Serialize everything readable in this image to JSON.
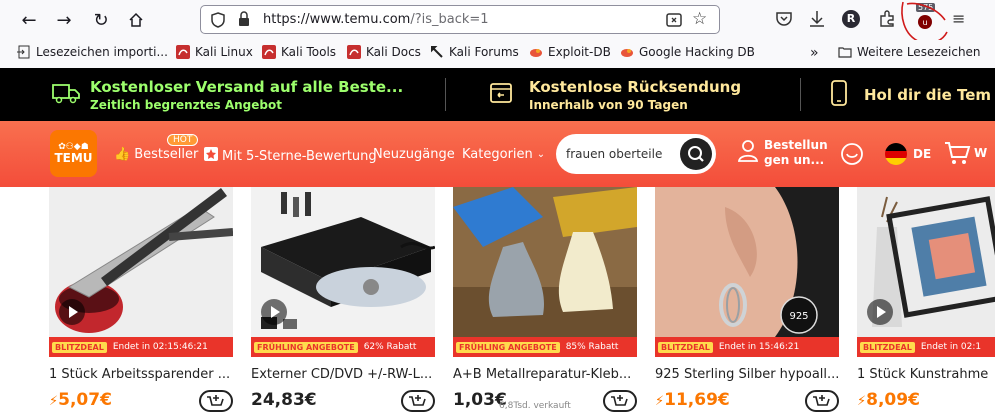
{
  "browser": {
    "url_main": "https://www.temu.com",
    "url_rest": "/?is_back=1",
    "badge_count": "575",
    "profile_letter": "R"
  },
  "bookmarks": [
    {
      "label": "Lesezeichen importi...",
      "icon": "import-icon"
    },
    {
      "label": "Kali Linux",
      "icon": "kali-icon"
    },
    {
      "label": "Kali Tools",
      "icon": "kali-icon"
    },
    {
      "label": "Kali Docs",
      "icon": "kali-icon"
    },
    {
      "label": "Kali Forums",
      "icon": "kali-forum-icon"
    },
    {
      "label": "Exploit-DB",
      "icon": "exploit-icon"
    },
    {
      "label": "Google Hacking DB",
      "icon": "exploit-icon"
    }
  ],
  "bookmarks_more": "Weitere Lesezeichen",
  "promo": [
    {
      "title": "Kostenloser Versand auf alle Beste...",
      "sub": "Zeitlich begrenztes Angebot"
    },
    {
      "title": "Kostenlose Rücksendung",
      "sub": "Innerhalb von 90 Tagen"
    },
    {
      "title": "Hol dir die Tem",
      "sub": ""
    }
  ],
  "header": {
    "logo_text": "TEMU",
    "hot": "HOT",
    "nav": [
      "Bestseller",
      "Mit 5-Sterne-Bewertung",
      "Neuzugänge",
      "Kategorien"
    ],
    "search_placeholder": "frauen oberteile",
    "orders_line1": "Bestellun",
    "orders_line2": "gen un...",
    "lang": "DE",
    "cart_letter": "W"
  },
  "products": [
    {
      "title": "1 Stück Arbeitssparender ...",
      "price": "5,07€",
      "deal_badge": "BLITZDEAL",
      "deal_text": "Endet in 02:15:46:21",
      "sold": "",
      "price_color": "orange"
    },
    {
      "title": "Externer CD/DVD +/-RW-L...",
      "price": "24,83€",
      "deal_badge": "FRÜHLING ANGEBOTE",
      "deal_text": "62% Rabatt",
      "sold": "",
      "price_color": "black"
    },
    {
      "title": "A+B Metallreparatur-Kleb...",
      "price": "1,03€",
      "deal_badge": "FRÜHLING ANGEBOTE",
      "deal_text": "85% Rabatt",
      "sold": "6,8Tsd. verkauft",
      "price_color": "black"
    },
    {
      "title": "925 Sterling Silber hypoall...",
      "price": "11,69€",
      "deal_badge": "BLITZDEAL",
      "deal_text": "Endet in 15:46:21",
      "sold": "",
      "price_color": "orange"
    },
    {
      "title": "1 Stück Kunstrahme",
      "price": "8,09€",
      "deal_badge": "BLITZDEAL",
      "deal_text": "Endet in 02:1",
      "sold": "",
      "price_color": "orange"
    }
  ]
}
